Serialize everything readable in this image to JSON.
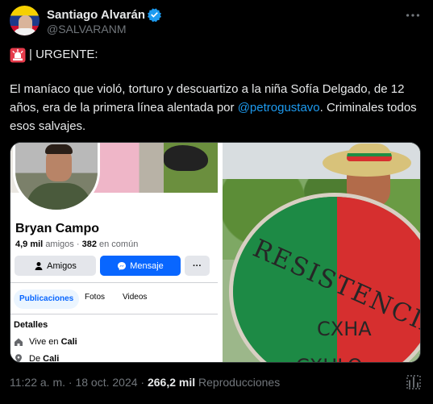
{
  "author": {
    "name": "Santiago Alvarán",
    "handle": "@SALVARANM",
    "verified": true,
    "icons": {
      "verified": "verified-badge-icon",
      "more": "more-options-icon"
    }
  },
  "tweet": {
    "alert_icon": "rotating-light-emoji",
    "alert_text": "| URGENTE:",
    "body_before": "El maníaco que violó, torturo y descuartizo a la niña Sofía Delgado, de 12 años, era de la primera línea alentada por ",
    "mention": "@petrogustavo",
    "body_after": ". Criminales todos esos salvajes."
  },
  "media": {
    "profile_card": {
      "name": "Bryan Campo",
      "friends_count": "4,9 mil",
      "friends_label": "amigos",
      "separator": "·",
      "common_count": "382",
      "common_label": "en común",
      "friends_button": "Amigos",
      "message_button": "Mensaje",
      "more_button": "···",
      "tabs": [
        "Publicaciones",
        "Fotos",
        "Videos"
      ],
      "details_label": "Detalles",
      "lives_in_label": "Vive en",
      "lives_in_value": "Cali",
      "from_label": "De",
      "from_value": "Cali"
    },
    "photo": {
      "shield_text_1": "RESISTENCIA",
      "shield_text_2": "CXHA",
      "shield_text_3": "CXHLO"
    }
  },
  "meta": {
    "time": "11:22 a. m.",
    "separator": "·",
    "date": "18 oct. 2024",
    "separator_2": "·",
    "views_count": "266,2 mil",
    "views_label": "Reproducciones",
    "stats_icon": "analytics-icon"
  },
  "colors": {
    "background": "#000000",
    "text": "#e7e9ea",
    "muted": "#71767b",
    "link": "#1d9bf0",
    "facebook_blue": "#0866ff"
  }
}
